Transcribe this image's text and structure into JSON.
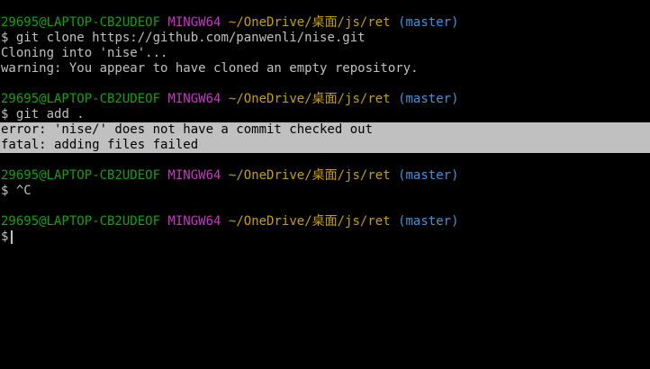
{
  "colors": {
    "background": "#000000",
    "text": "#c0c0c0",
    "user_host": "#13a10e",
    "system": "#c837c5",
    "path": "#c4a000",
    "branch": "#3a96dd",
    "highlight_bg": "#c0c0c0",
    "highlight_fg": "#000000"
  },
  "prompt": {
    "user_host": "29695@LAPTOP-CB2UDEOF",
    "system": "MINGW64",
    "path": "~/OneDrive/桌面/js/ret",
    "branch": "(master)",
    "symbol": "$"
  },
  "blocks": [
    {
      "command": "git clone https://github.com/panwenli/nise.git",
      "output": [
        "Cloning into 'nise'...",
        "warning: You appear to have cloned an empty repository."
      ]
    },
    {
      "command": "git add .",
      "output": [
        "error: 'nise/' does not have a commit checked out",
        "fatal: adding files failed"
      ]
    },
    {
      "command": "^C",
      "output": []
    }
  ]
}
